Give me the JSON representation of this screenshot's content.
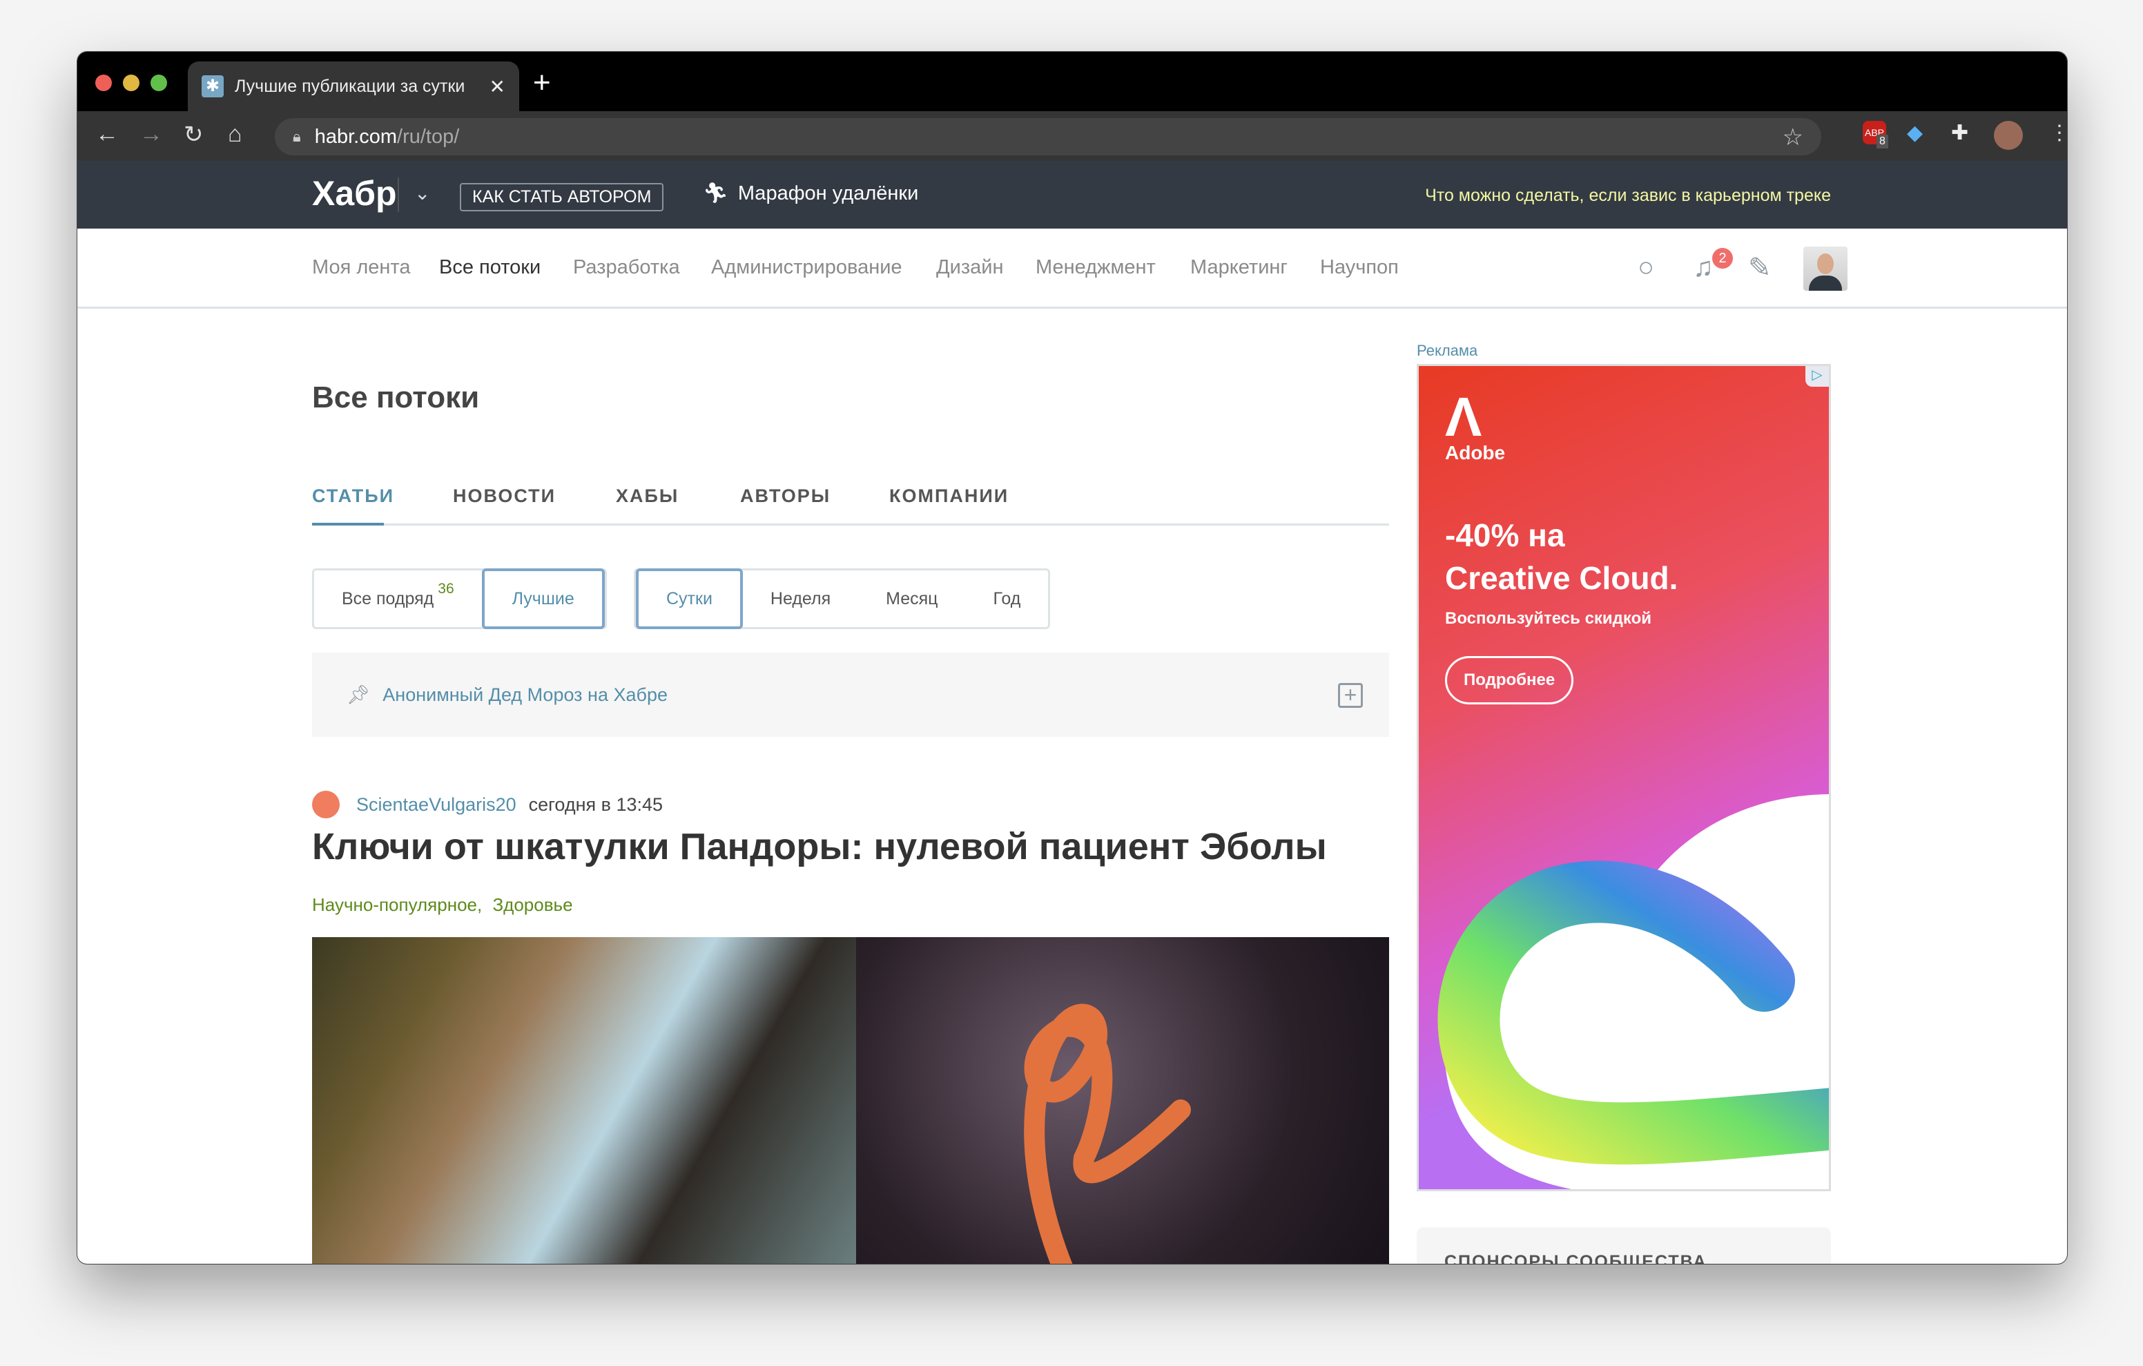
{
  "browser": {
    "tab_title": "Лучшие публикации за сутки",
    "url_host": "habr.com",
    "url_path": "/ru/top/",
    "new_tab": "+",
    "close": "✕",
    "abp_count": "8"
  },
  "topbar": {
    "logo": "Хабр",
    "become_author": "КАК СТАТЬ АВТОРОМ",
    "marathon": "Марафон удалёнки",
    "promo": "Что можно сделать, если завис в карьерном треке"
  },
  "nav": {
    "items": [
      "Моя лента",
      "Все потоки",
      "Разработка",
      "Администрирование",
      "Дизайн",
      "Менеджмент",
      "Маркетинг",
      "Научпоп"
    ],
    "notifications": "2"
  },
  "page": {
    "title": "Все потоки",
    "tabs": [
      "СТАТЬИ",
      "НОВОСТИ",
      "ХАБЫ",
      "АВТОРЫ",
      "КОМПАНИИ"
    ]
  },
  "filters": {
    "all": "Все подряд",
    "all_count": "36",
    "best": "Лучшие",
    "periods": [
      "Сутки",
      "Неделя",
      "Месяц",
      "Год"
    ]
  },
  "pinned": {
    "text": "Анонимный Дед Мороз на Хабре"
  },
  "article": {
    "author": "ScientaeVulgaris20",
    "date": "сегодня в 13:45",
    "title": "Ключи от шкатулки Пандоры: нулевой пациент Эболы",
    "tags": [
      "Научно-популярное,",
      "Здоровье"
    ]
  },
  "ad": {
    "label": "Реклама",
    "brand": "Adobe",
    "headline1": "-40% на",
    "headline2": "Creative Cloud.",
    "sub": "Воспользуйтесь скидкой",
    "button": "Подробнее"
  },
  "sponsors": {
    "title": "СПОНСОРЫ СООБЩЕСТВА"
  }
}
